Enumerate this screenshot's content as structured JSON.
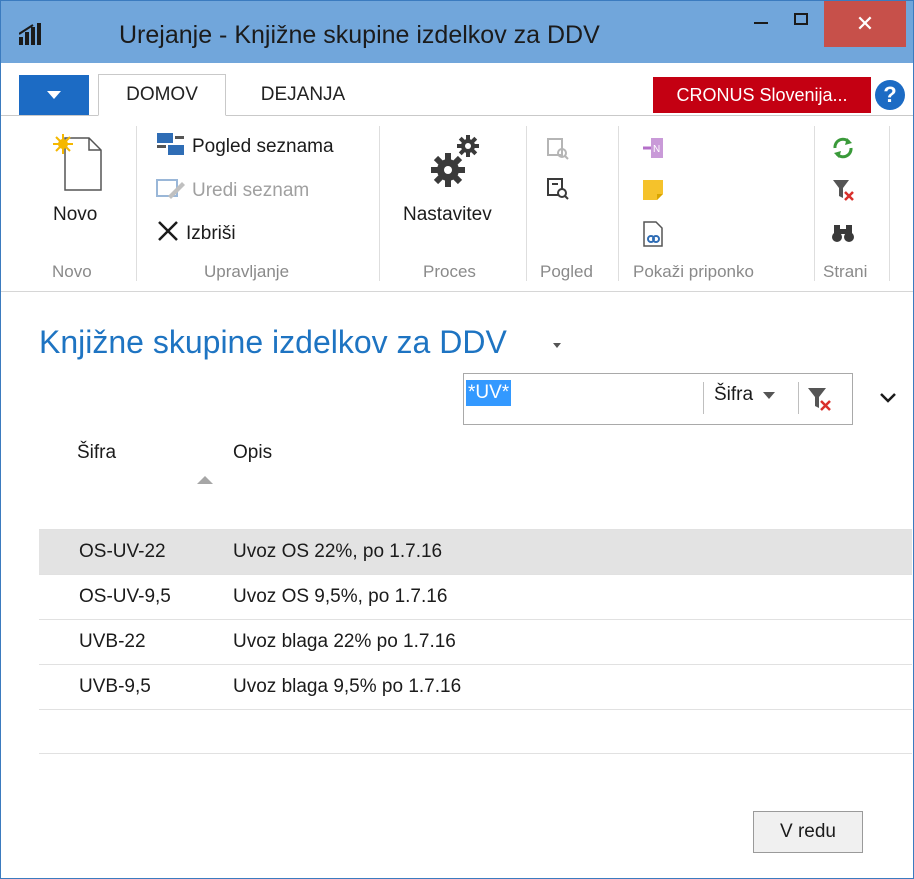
{
  "window": {
    "title": "Urejanje - Knjižne skupine izdelkov za DDV",
    "close_glyph": "✕"
  },
  "tabs": {
    "home": "DOMOV",
    "actions": "DEJANJA"
  },
  "company": "CRONUS Slovenija...",
  "help_glyph": "?",
  "ribbon": {
    "new_group": {
      "button": "Novo",
      "label": "Novo"
    },
    "manage_group": {
      "view_list": "Pogled seznama",
      "edit_list": "Uredi seznam",
      "delete": "Izbriši",
      "label": "Upravljanje"
    },
    "process_group": {
      "setup": "Nastavitev",
      "label": "Proces"
    },
    "view_label": "Pogled",
    "attachment_label": "Pokaži priponko",
    "page_label": "Strani"
  },
  "page": {
    "title": "Knjižne skupine izdelkov za DDV"
  },
  "filter": {
    "value": "*UV*",
    "field": "Šifra"
  },
  "columns": {
    "code": "Šifra",
    "description": "Opis"
  },
  "rows": [
    {
      "code": "OS-UV-22",
      "description": "Uvoz OS 22%, po 1.7.16",
      "selected": true
    },
    {
      "code": "OS-UV-9,5",
      "description": "Uvoz OS 9,5%, po 1.7.16",
      "selected": false
    },
    {
      "code": "UVB-22",
      "description": "Uvoz blaga 22% po 1.7.16",
      "selected": false
    },
    {
      "code": "UVB-9,5",
      "description": "Uvoz blaga 9,5% po 1.7.16",
      "selected": false
    }
  ],
  "ok_button": "V redu",
  "colors": {
    "title_bar": "#71a6db",
    "accent_blue": "#1e74c2",
    "company_red": "#c40012",
    "close_red": "#c7504a"
  }
}
